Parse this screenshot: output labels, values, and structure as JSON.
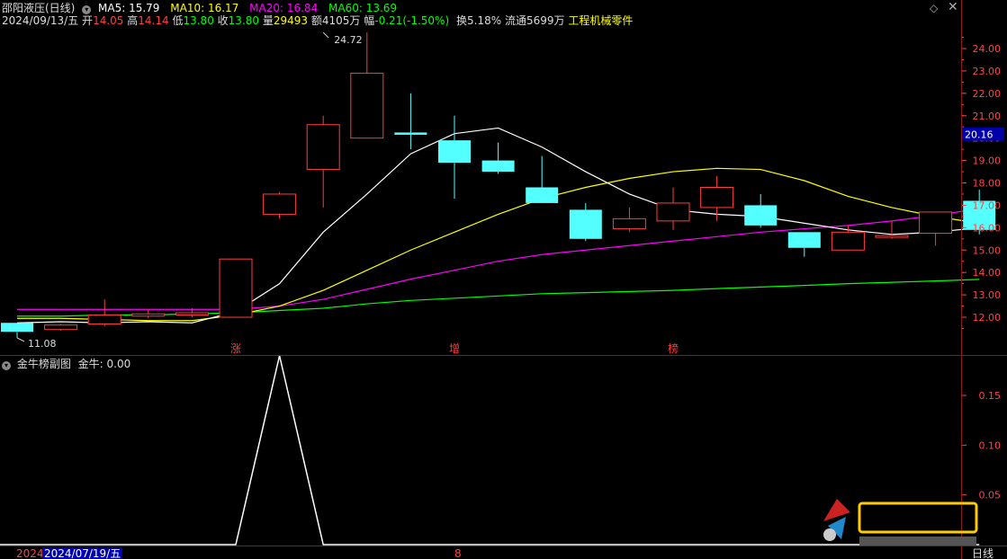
{
  "colors": {
    "up": "#ff3d3d",
    "down": "#54ffff",
    "ma5": "#ffffff",
    "ma10": "#ffff00",
    "ma20": "#ff00ff",
    "ma60": "#00ff00",
    "sub": "#ffffff",
    "grid": "#8b1a1a",
    "axis": "#ff4444",
    "highlight": "#0000aa"
  },
  "header": {
    "title": "邵阳液压(日线)",
    "ma5_label": "MA5: 15.79",
    "ma10_label": "MA10: 16.17",
    "ma20_label": "MA20: 16.84",
    "ma60_label": "MA60: 13.69",
    "date": "2024/09/13/五",
    "open_label": "开",
    "open": "14.05",
    "high_label": "高",
    "high": "14.14",
    "low_label": "低",
    "low": "13.80",
    "close_label": "收",
    "close": "13.80",
    "vol_label": "量",
    "vol": "29493",
    "amount": "额4105万",
    "change_label": "幅",
    "change": "-0.21(-1.50%)",
    "turnover": "换5.18%",
    "float": "流通5699万",
    "industry": "工程机械零件"
  },
  "indicator": {
    "title": "金牛榜副图",
    "value_label": "金牛: 0.00"
  },
  "footer": {
    "left_year": "2024",
    "cursor_date": "2024/07/19/五",
    "mid_mark": "8",
    "period": "日线"
  },
  "markers": [
    {
      "text": "涨",
      "index": 5
    },
    {
      "text": "增",
      "index": 10
    },
    {
      "text": "榜",
      "index": 15
    }
  ],
  "chart_data": {
    "type": "candlestick",
    "main_ylim": [
      11.0,
      25.0
    ],
    "main_yticks": [
      12,
      13,
      14,
      15,
      16,
      17,
      18,
      19,
      20,
      21,
      22,
      23,
      24
    ],
    "price_tags": {
      "current": "20.16",
      "current_value": 20.16,
      "max": "24.72",
      "max_value": 24.72,
      "max_index": 7,
      "min": "11.08",
      "min_value": 11.08,
      "min_index": 0
    },
    "candles": [
      {
        "o": 11.75,
        "c": 11.35,
        "h": 11.75,
        "l": 11.08
      },
      {
        "o": 11.45,
        "c": 11.65,
        "h": 11.7,
        "l": 11.4
      },
      {
        "o": 11.7,
        "c": 12.1,
        "h": 12.8,
        "l": 11.6
      },
      {
        "o": 12.05,
        "c": 12.15,
        "h": 12.35,
        "l": 11.95
      },
      {
        "o": 12.1,
        "c": 12.2,
        "h": 12.4,
        "l": 12.0
      },
      {
        "o": 12.0,
        "c": 14.6,
        "h": 14.6,
        "l": 12.0
      },
      {
        "o": 16.6,
        "c": 17.5,
        "h": 17.6,
        "l": 16.4
      },
      {
        "o": 18.6,
        "c": 20.6,
        "h": 21.0,
        "l": 16.9
      },
      {
        "o": 20.0,
        "c": 22.9,
        "h": 24.72,
        "l": 20.0
      },
      {
        "o": 20.25,
        "c": 20.15,
        "h": 22.0,
        "l": 19.5
      },
      {
        "o": 19.9,
        "c": 18.9,
        "h": 21.0,
        "l": 17.3
      },
      {
        "o": 19.0,
        "c": 18.5,
        "h": 19.8,
        "l": 18.4
      },
      {
        "o": 17.8,
        "c": 17.1,
        "h": 19.2,
        "l": 17.1
      },
      {
        "o": 16.8,
        "c": 15.5,
        "h": 17.1,
        "l": 15.4
      },
      {
        "o": 15.95,
        "c": 16.4,
        "h": 16.9,
        "l": 15.8
      },
      {
        "o": 16.3,
        "c": 17.1,
        "h": 17.8,
        "l": 15.9
      },
      {
        "o": 16.9,
        "c": 17.8,
        "h": 18.3,
        "l": 16.3
      },
      {
        "o": 17.0,
        "c": 16.1,
        "h": 17.5,
        "l": 16.0
      },
      {
        "o": 15.8,
        "c": 15.1,
        "h": 15.8,
        "l": 14.7
      },
      {
        "o": 15.0,
        "c": 15.8,
        "h": 16.1,
        "l": 15.0
      },
      {
        "o": 15.6,
        "c": 15.65,
        "h": 16.3,
        "l": 15.5
      },
      {
        "o": 15.75,
        "c": 16.7,
        "h": 16.7,
        "l": 15.2
      },
      {
        "o": 17.2,
        "c": 15.9,
        "h": 17.7,
        "l": 15.7
      }
    ],
    "ma5": [
      11.75,
      11.8,
      11.75,
      11.8,
      11.75,
      12.25,
      13.5,
      15.8,
      17.5,
      19.3,
      20.2,
      20.45,
      19.6,
      18.5,
      17.5,
      16.8,
      16.6,
      16.5,
      16.2,
      15.9,
      15.7,
      15.8,
      16.0
    ],
    "ma10": [
      11.95,
      11.95,
      11.9,
      11.85,
      11.85,
      12.1,
      12.5,
      13.2,
      14.1,
      15.0,
      15.8,
      16.6,
      17.3,
      17.8,
      18.2,
      18.5,
      18.65,
      18.6,
      18.1,
      17.4,
      16.9,
      16.5,
      16.2
    ],
    "ma20": [
      12.35,
      12.35,
      12.35,
      12.35,
      12.35,
      12.35,
      12.5,
      12.8,
      13.25,
      13.7,
      14.1,
      14.5,
      14.8,
      15.0,
      15.2,
      15.4,
      15.6,
      15.8,
      15.95,
      16.1,
      16.3,
      16.55,
      16.85
    ],
    "ma60": [
      12.05,
      12.05,
      12.1,
      12.1,
      12.15,
      12.2,
      12.3,
      12.4,
      12.6,
      12.75,
      12.85,
      12.95,
      13.05,
      13.1,
      13.15,
      13.2,
      13.28,
      13.35,
      13.42,
      13.5,
      13.56,
      13.62,
      13.69
    ],
    "sub_ylim": [
      0,
      0.2
    ],
    "sub_yticks": [
      0.05,
      0.1,
      0.15
    ],
    "sub_values": [
      0,
      0,
      0,
      0,
      0,
      0,
      0.19,
      0,
      0,
      0,
      0,
      0,
      0,
      0,
      0,
      0,
      0,
      0,
      0,
      0,
      0,
      0,
      0
    ]
  }
}
